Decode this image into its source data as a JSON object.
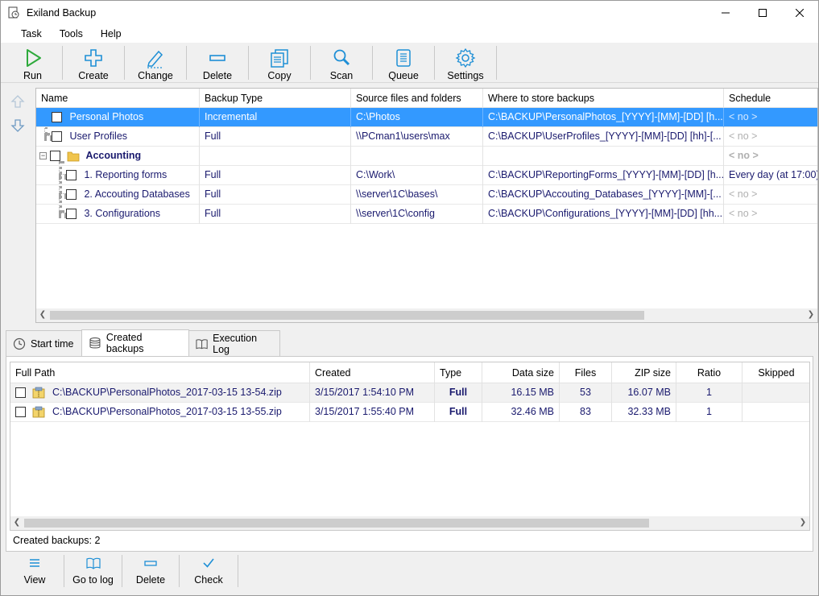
{
  "window": {
    "title": "Exiland Backup"
  },
  "menu": [
    {
      "label": "Task"
    },
    {
      "label": "Tools"
    },
    {
      "label": "Help"
    }
  ],
  "toolbar": [
    {
      "label": "Run",
      "icon": "play-icon"
    },
    {
      "label": "Create",
      "icon": "plus-icon"
    },
    {
      "label": "Change",
      "icon": "pencil-icon"
    },
    {
      "label": "Delete",
      "icon": "minus-icon"
    },
    {
      "label": "Copy",
      "icon": "copy-icon"
    },
    {
      "label": "Scan",
      "icon": "magnifier-icon"
    },
    {
      "label": "Queue",
      "icon": "list-icon"
    },
    {
      "label": "Settings",
      "icon": "gear-icon"
    }
  ],
  "tasks": {
    "columns": [
      "Name",
      "Backup Type",
      "Source files and folders",
      "Where to store backups",
      "Schedule"
    ],
    "rows": [
      {
        "name": "Personal Photos",
        "type": "Incremental",
        "source": "C:\\Photos",
        "dest": "C:\\BACKUP\\PersonalPhotos_[YYYY]-[MM]-[DD] [h...",
        "schedule": "< no >"
      },
      {
        "name": "User Profiles",
        "type": "Full",
        "source": "\\\\PCman1\\users\\max",
        "dest": "C:\\BACKUP\\UserProfiles_[YYYY]-[MM]-[DD] [hh]-[...",
        "schedule": "< no >"
      },
      {
        "name": "Accounting",
        "type": "",
        "source": "",
        "dest": "",
        "schedule": "< no >"
      },
      {
        "name": "1. Reporting forms",
        "type": "Full",
        "source": "C:\\Work\\",
        "dest": "C:\\BACKUP\\ReportingForms_[YYYY]-[MM]-[DD] [h...",
        "schedule": "Every day (at 17:00)"
      },
      {
        "name": "2. Accouting Databases",
        "type": "Full",
        "source": "\\\\server\\1C\\bases\\",
        "dest": "C:\\BACKUP\\Accouting_Databases_[YYYY]-[MM]-[...",
        "schedule": "< no >"
      },
      {
        "name": "3. Configurations",
        "type": "Full",
        "source": "\\\\server\\1C\\config",
        "dest": "C:\\BACKUP\\Configurations_[YYYY]-[MM]-[DD] [hh...",
        "schedule": "< no >"
      }
    ]
  },
  "tabs": [
    {
      "label": "Start time",
      "icon": "clock-icon"
    },
    {
      "label": "Created backups",
      "icon": "database-icon"
    },
    {
      "label": "Execution Log",
      "icon": "book-icon"
    }
  ],
  "backups": {
    "columns": [
      "Full Path",
      "Created",
      "Type",
      "Data size",
      "Files",
      "ZIP size",
      "Ratio",
      "Skipped"
    ],
    "rows": [
      {
        "path": "C:\\BACKUP\\PersonalPhotos_2017-03-15 13-54.zip",
        "created": "3/15/2017  1:54:10 PM",
        "type": "Full",
        "data_size": "16.15 MB",
        "files": "53",
        "zip_size": "16.07 MB",
        "ratio": "1",
        "skipped": ""
      },
      {
        "path": "C:\\BACKUP\\PersonalPhotos_2017-03-15 13-55.zip",
        "created": "3/15/2017  1:55:40 PM",
        "type": "Full",
        "data_size": "32.46 MB",
        "files": "83",
        "zip_size": "32.33 MB",
        "ratio": "1",
        "skipped": ""
      }
    ]
  },
  "status": {
    "text": "Created backups: 2"
  },
  "bottom_toolbar": [
    {
      "label": "View",
      "icon": "lines-icon"
    },
    {
      "label": "Go to log",
      "icon": "book-icon"
    },
    {
      "label": "Delete",
      "icon": "minus-icon"
    },
    {
      "label": "Check",
      "icon": "checkmark-icon"
    }
  ],
  "colors": {
    "selection": "#3399ff",
    "accent": "#1e8fd6",
    "play": "#2eaa3c",
    "text_blue": "#1a1a6e"
  }
}
